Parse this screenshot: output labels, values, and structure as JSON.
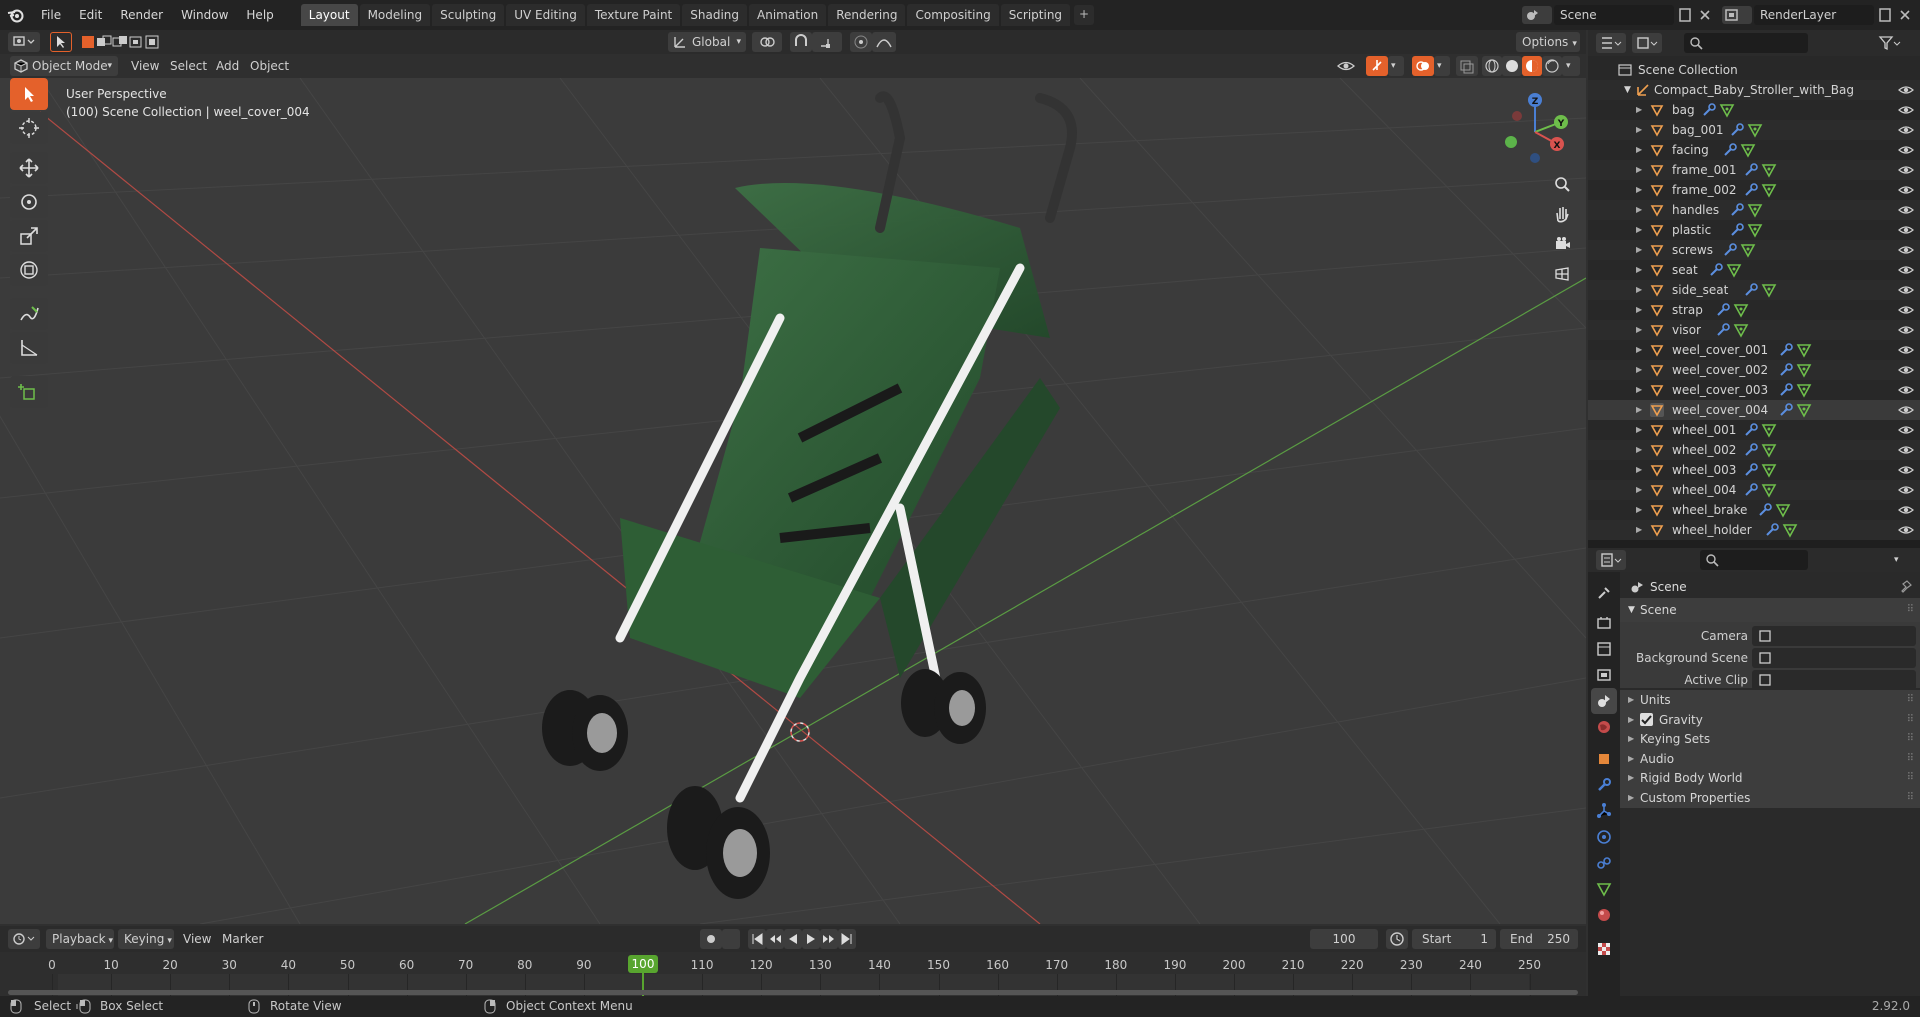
{
  "app": {
    "version": "2.92.0"
  },
  "menubar": {
    "items": [
      "File",
      "Edit",
      "Render",
      "Window",
      "Help"
    ]
  },
  "workspaces": {
    "tabs": [
      "Layout",
      "Modeling",
      "Sculpting",
      "UV Editing",
      "Texture Paint",
      "Shading",
      "Animation",
      "Rendering",
      "Compositing",
      "Scripting"
    ],
    "active": "Layout",
    "add": "+"
  },
  "scene": {
    "name": "Scene",
    "render_layer": "RenderLayer"
  },
  "viewport_header": {
    "mode": "Object Mode",
    "menus": [
      "View",
      "Select",
      "Add",
      "Object"
    ],
    "orientation": "Global",
    "options": "Options"
  },
  "viewport": {
    "perspective": "User Perspective",
    "context": "(100) Scene Collection | weel_cover_004",
    "gizmo": {
      "x": "X",
      "y": "Y",
      "z": "Z"
    }
  },
  "outliner": {
    "root": "Scene Collection",
    "collection": "Compact_Baby_Stroller_with_Bag",
    "objects": [
      "bag",
      "bag_001",
      "facing",
      "frame_001",
      "frame_002",
      "handles",
      "plastic",
      "screws",
      "seat",
      "side_seat",
      "strap",
      "visor",
      "weel_cover_001",
      "weel_cover_002",
      "weel_cover_003",
      "weel_cover_004",
      "wheel_001",
      "wheel_002",
      "wheel_003",
      "wheel_004",
      "wheel_brake",
      "wheel_holder"
    ],
    "selected": "weel_cover_004"
  },
  "properties": {
    "context": "Scene",
    "panel_title": "Scene",
    "fields": [
      {
        "label": "Camera",
        "value": ""
      },
      {
        "label": "Background Scene",
        "value": ""
      },
      {
        "label": "Active Clip",
        "value": ""
      }
    ],
    "subpanels": [
      "Units",
      "Gravity",
      "Keying Sets",
      "Audio",
      "Rigid Body World",
      "Custom Properties"
    ],
    "gravity_checked": true
  },
  "timeline": {
    "menus": [
      "Playback",
      "Keying",
      "View",
      "Marker"
    ],
    "current_frame": "100",
    "start_label": "Start",
    "start": "1",
    "end_label": "End",
    "end": "250",
    "ruler": [
      "0",
      "10",
      "20",
      "30",
      "40",
      "50",
      "60",
      "70",
      "80",
      "90",
      "100",
      "110",
      "120",
      "130",
      "140",
      "150",
      "160",
      "170",
      "180",
      "190",
      "200",
      "210",
      "220",
      "230",
      "240",
      "250"
    ]
  },
  "statusbar": {
    "select": "Select",
    "box_select": "Box Select",
    "rotate_view": "Rotate View",
    "context_menu": "Object Context Menu"
  },
  "colors": {
    "accent": "#e4612b",
    "selection": "#4772b3",
    "frame_marker": "#58a52f",
    "x_axis": "#d9534f",
    "y_axis": "#6ebe4b",
    "z_axis": "#4a7fd4",
    "mesh_icon": "#f0a050",
    "stroller_fabric": "#2f6135"
  }
}
